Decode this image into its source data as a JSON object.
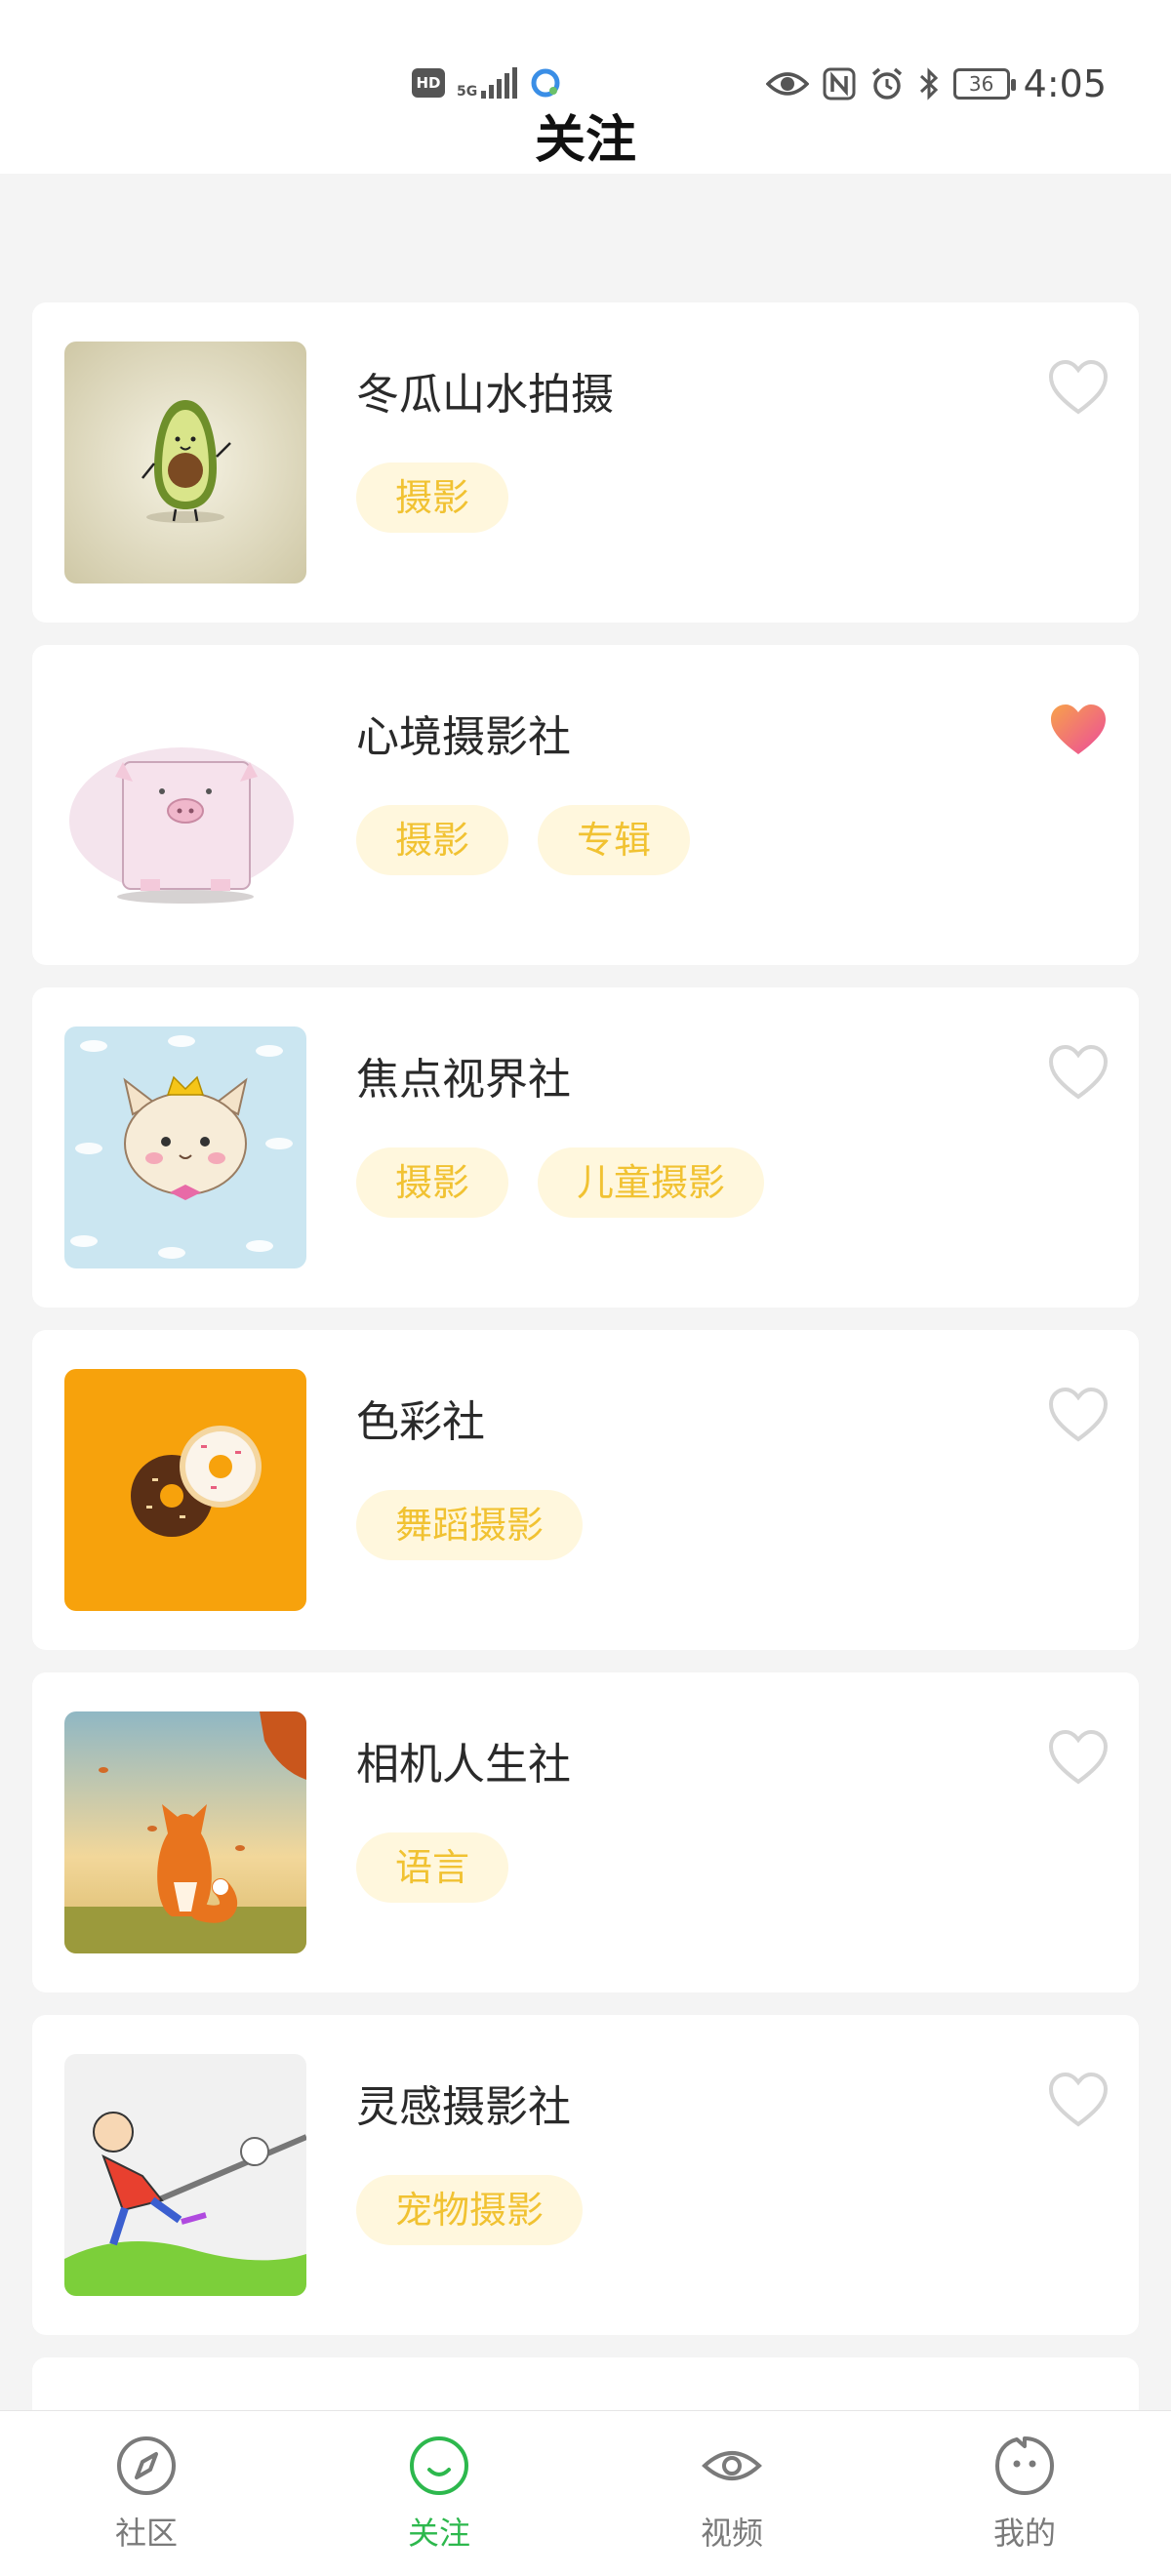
{
  "status_bar": {
    "left_icons": [
      "hd-icon",
      "5g-signal-icon",
      "browser-icon"
    ],
    "network_label": "5G",
    "hd_label": "HD",
    "right_icons": [
      "eye-icon",
      "nfc-icon",
      "alarm-icon",
      "bluetooth-icon"
    ],
    "battery": "36",
    "time": "4:05"
  },
  "header": {
    "title": "关注"
  },
  "colors": {
    "tag_bg": "#fff7dd",
    "tag_text": "#f1c232",
    "heart_outline": "#d5d5d5",
    "heart_filled": "#f0668e",
    "tab_active": "#2db84d",
    "tab_inactive": "#7a7a7a"
  },
  "clubs": [
    {
      "name": "冬瓜山水拍摄",
      "tags": [
        "摄影"
      ],
      "favorited": false,
      "image": "avocado-illustration"
    },
    {
      "name": "心境摄影社",
      "tags": [
        "摄影",
        "专辑"
      ],
      "favorited": true,
      "image": "pig-illustration"
    },
    {
      "name": "焦点视界社",
      "tags": [
        "摄影",
        "儿童摄影"
      ],
      "favorited": false,
      "image": "cat-illustration"
    },
    {
      "name": "色彩社",
      "tags": [
        "舞蹈摄影"
      ],
      "favorited": false,
      "image": "donut-illustration"
    },
    {
      "name": "相机人生社",
      "tags": [
        "语言"
      ],
      "favorited": false,
      "image": "fox-illustration"
    },
    {
      "name": "灵感摄影社",
      "tags": [
        "宠物摄影"
      ],
      "favorited": false,
      "image": "boy-skating-illustration"
    }
  ],
  "tabbar": {
    "items": [
      {
        "label": "社区",
        "icon": "compass-icon",
        "active": false
      },
      {
        "label": "关注",
        "icon": "smile-icon",
        "active": true
      },
      {
        "label": "视频",
        "icon": "eye-icon",
        "active": false
      },
      {
        "label": "我的",
        "icon": "face-icon",
        "active": false
      }
    ]
  }
}
